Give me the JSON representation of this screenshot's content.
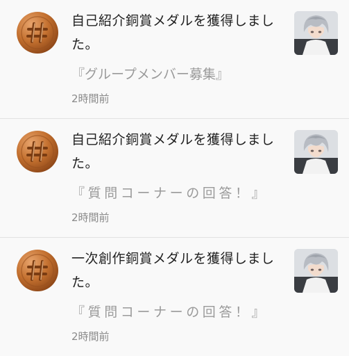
{
  "notifications": [
    {
      "title": "自己紹介銅賞メダルを獲得しました。",
      "subtitle": "『グループメンバー募集』",
      "time": "2時間前",
      "medal_icon": "bronze-hash-medal-icon",
      "avatar_icon": "user-avatar"
    },
    {
      "title": "自己紹介銅賞メダルを獲得しました。",
      "subtitle": "『質問コーナーの回答！』",
      "time": "2時間前",
      "medal_icon": "bronze-hash-medal-icon",
      "avatar_icon": "user-avatar"
    },
    {
      "title": "一次創作銅賞メダルを獲得しました。",
      "subtitle": "『質問コーナーの回答！』",
      "time": "2時間前",
      "medal_icon": "bronze-hash-medal-icon",
      "avatar_icon": "user-avatar"
    }
  ],
  "colors": {
    "medal_bronze": "#c06a2c",
    "medal_highlight": "#e5a16a",
    "title_text": "#222222",
    "subtitle_text": "#9a9a9a",
    "time_text": "#8a8a8a",
    "divider": "#e2e2e2",
    "background": "#f9f9f9"
  }
}
